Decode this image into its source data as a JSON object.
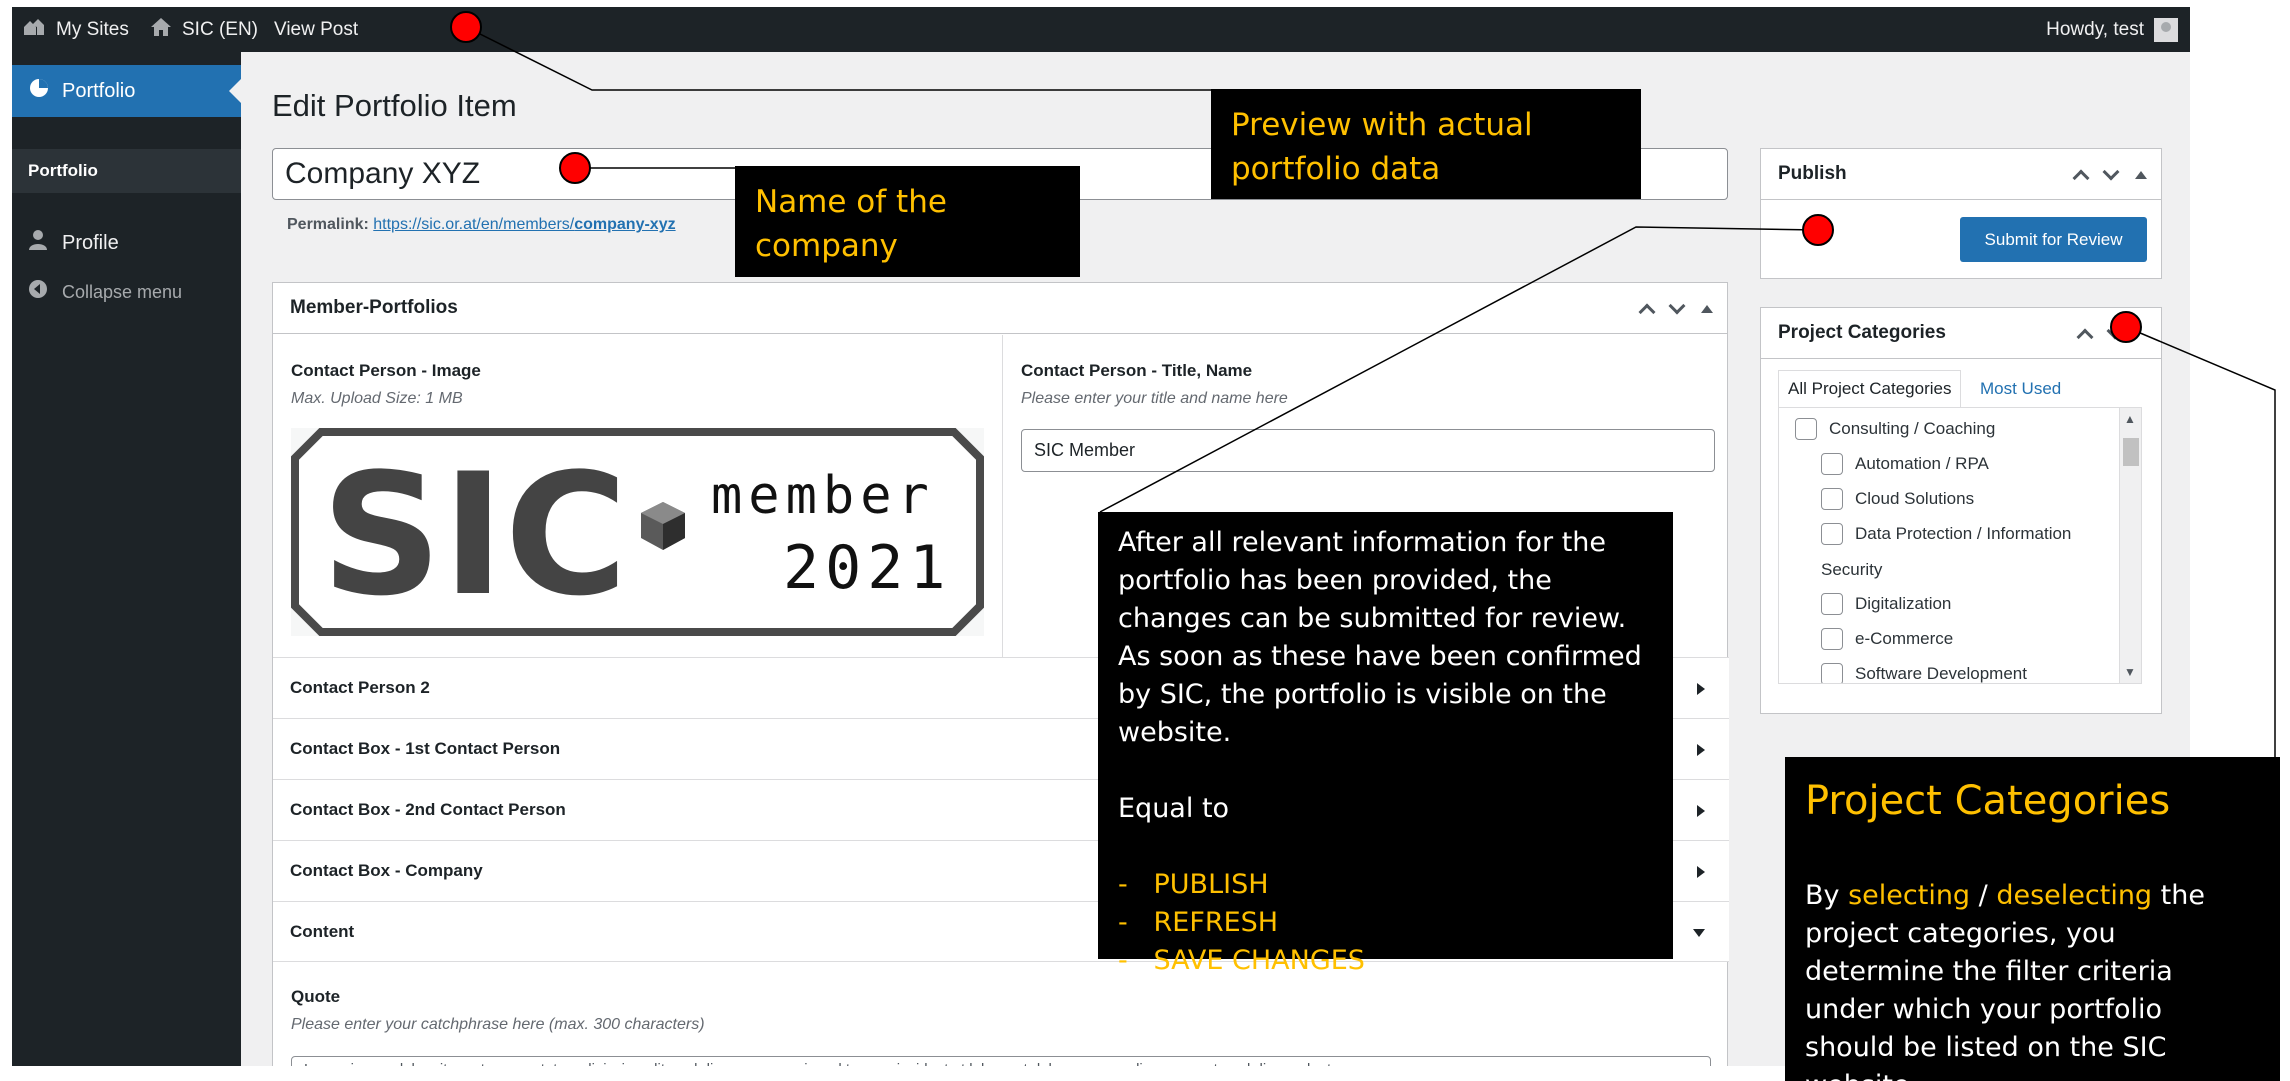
{
  "admin_bar": {
    "my_sites": "My Sites",
    "site_name": "SIC (EN)",
    "view_post": "View Post",
    "howdy": "Howdy, test"
  },
  "sidebar": {
    "portfolio": "Portfolio",
    "portfolio_sub": "Portfolio",
    "profile": "Profile",
    "collapse": "Collapse menu"
  },
  "editor": {
    "page_title": "Edit Portfolio Item",
    "post_title": "Company XYZ",
    "permalink_label": "Permalink:",
    "permalink_url_base": "https://sic.or.at/en/members/",
    "permalink_slug": "company-xyz"
  },
  "member_portfolios": {
    "title": "Member-Portfolios",
    "image_label": "Contact Person - Image",
    "image_desc": "Max. Upload Size: 1 MB",
    "name_label": "Contact Person - Title, Name",
    "name_desc": "Please enter your title and name here",
    "name_value": "SIC Member",
    "logo": {
      "brand": "SIC",
      "line1": "member",
      "line2": "2021"
    },
    "sections": [
      "Contact Person 2",
      "Contact Box - 1st Contact Person",
      "Contact Box - 2nd Contact Person",
      "Contact Box - Company",
      "Content"
    ],
    "quote_label": "Quote",
    "quote_desc": "Please enter your catchphrase here (max. 300 characters)",
    "quote_value": "Lorem ipsum dolor sit amet, consectetur adipiscing elit, sed diam nonumy eirmod tempor invidunt ut labore et dolore magna aliquyam erat, sed diam voluptua."
  },
  "publish": {
    "title": "Publish",
    "submit": "Submit for Review"
  },
  "project_categories": {
    "title": "Project Categories",
    "tab_all": "All Project Categories",
    "tab_most_used": "Most Used",
    "items": [
      {
        "label": "Consulting / Coaching",
        "level": 0
      },
      {
        "label": "Automation / RPA",
        "level": 1
      },
      {
        "label": "Cloud Solutions",
        "level": 1
      },
      {
        "label": "Data Protection / Information",
        "level": 1
      },
      {
        "label": "Security",
        "level": 2
      },
      {
        "label": "Digitalization",
        "level": 1
      },
      {
        "label": "e-Commerce",
        "level": 1
      },
      {
        "label": "Software Development",
        "level": 1
      }
    ]
  },
  "annotations": {
    "preview": "Preview with actual portfolio data",
    "name_company": "Name of the company",
    "submit_note": "After all relevant information for the portfolio has been provided, the changes can be submitted for review. As soon as these have been confirmed by SIC, the portfolio is visible on the website.",
    "equal_to": "Equal to",
    "actions": [
      "PUBLISH",
      "REFRESH",
      "SAVE CHANGES"
    ],
    "cat_title": "Project Categories",
    "cat_text_pre": "By ",
    "cat_selecting": "selecting",
    "cat_slash": " / ",
    "cat_deselecting": "deselecting",
    "cat_text_post": " the project categories, you determine the filter criteria under which your portfolio should be listed on the SIC website"
  },
  "colors": {
    "admin_bar": "#1d2327",
    "accent": "#2271b1",
    "highlight": "#ffc000",
    "marker": "#ff0000"
  }
}
